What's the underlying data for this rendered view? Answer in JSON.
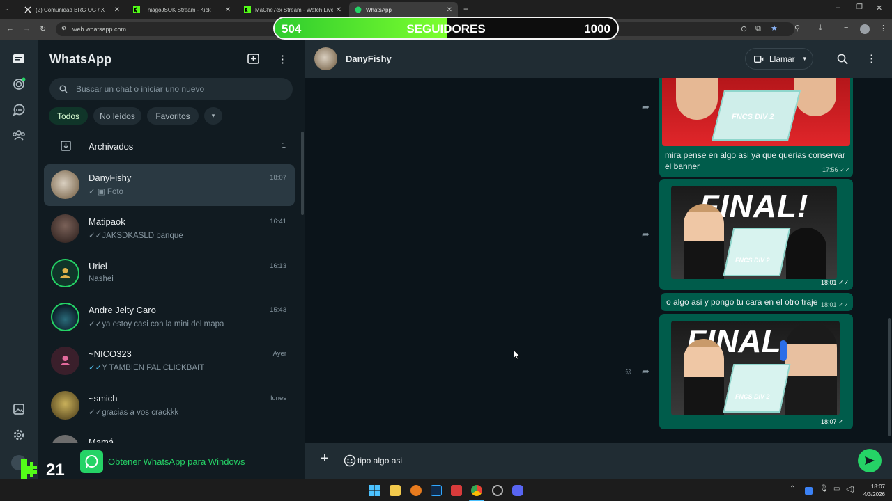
{
  "browser": {
    "tabs": [
      {
        "title": "(2) Comunidad BRG OG / X",
        "icon": "x-logo-icon"
      },
      {
        "title": "ThiagoJSOK Stream - Kick",
        "icon": "kick-logo-icon"
      },
      {
        "title": "MaChe7ex Stream - Watch Live",
        "icon": "kick-logo-icon"
      },
      {
        "title": "WhatsApp",
        "icon": "whatsapp-logo-icon"
      }
    ],
    "url": "web.whatsapp.com"
  },
  "overlay": {
    "current": "504",
    "label": "SEGUIDORES",
    "goal": "1000",
    "progress": 0.504
  },
  "sidebar": {
    "app_title": "WhatsApp",
    "search_placeholder": "Buscar un chat o iniciar uno nuevo",
    "filters": [
      "Todos",
      "No leídos",
      "Favoritos"
    ],
    "archived": {
      "label": "Archivados",
      "count": "1"
    },
    "chats": [
      {
        "name": "DanyFishy",
        "preview": "Foto",
        "time": "18:07",
        "status": "sent",
        "selected": true
      },
      {
        "name": "Matipaok",
        "preview": "JAKSDKASLD banque",
        "time": "16:41",
        "status": "read"
      },
      {
        "name": "Uriel",
        "preview": "Nashei",
        "time": "16:13",
        "status": "none"
      },
      {
        "name": "Andre Jelty Caro",
        "preview": "ya estoy casi con la mini del mapa",
        "time": "15:43",
        "status": "read"
      },
      {
        "name": "~NICO323",
        "preview": "Y TAMBIEN PAL CLICKBAIT",
        "time": "Ayer",
        "status": "read-blue"
      },
      {
        "name": "~smich",
        "preview": "gracias a vos crackkk",
        "time": "lunes",
        "status": "read"
      },
      {
        "name": "Mamá",
        "preview": "",
        "time": "",
        "status": "none"
      }
    ],
    "promo": "Obtener WhatsApp para Windows"
  },
  "chat": {
    "contact": "DanyFishy",
    "call_label": "Llamar",
    "messages": [
      {
        "type": "image-caption",
        "caption": "mira pense en algo asi ya que querias conservar el banner",
        "time": "17:56",
        "image_text": "FNCS DIV 2"
      },
      {
        "type": "image",
        "time": "18:01",
        "image_text": "FINAL!",
        "image_sub": "FNCS DIV 2"
      },
      {
        "type": "text",
        "text": "o algo asi y pongo tu cara en el otro traje",
        "time": "18:01"
      },
      {
        "type": "image",
        "time": "18:07",
        "image_text": "FINAL",
        "image_sub": "FNCS DIV 2"
      }
    ],
    "draft": "tipo algo asi"
  },
  "taskbar": {
    "time": "18:07",
    "date": "4/3/2026"
  },
  "stream_logo": "21",
  "colors": {
    "accent": "#00a884",
    "bubble": "#005c4b",
    "panel": "#111b21",
    "header": "#202c33",
    "overlay_fill": "#4bea2e"
  }
}
